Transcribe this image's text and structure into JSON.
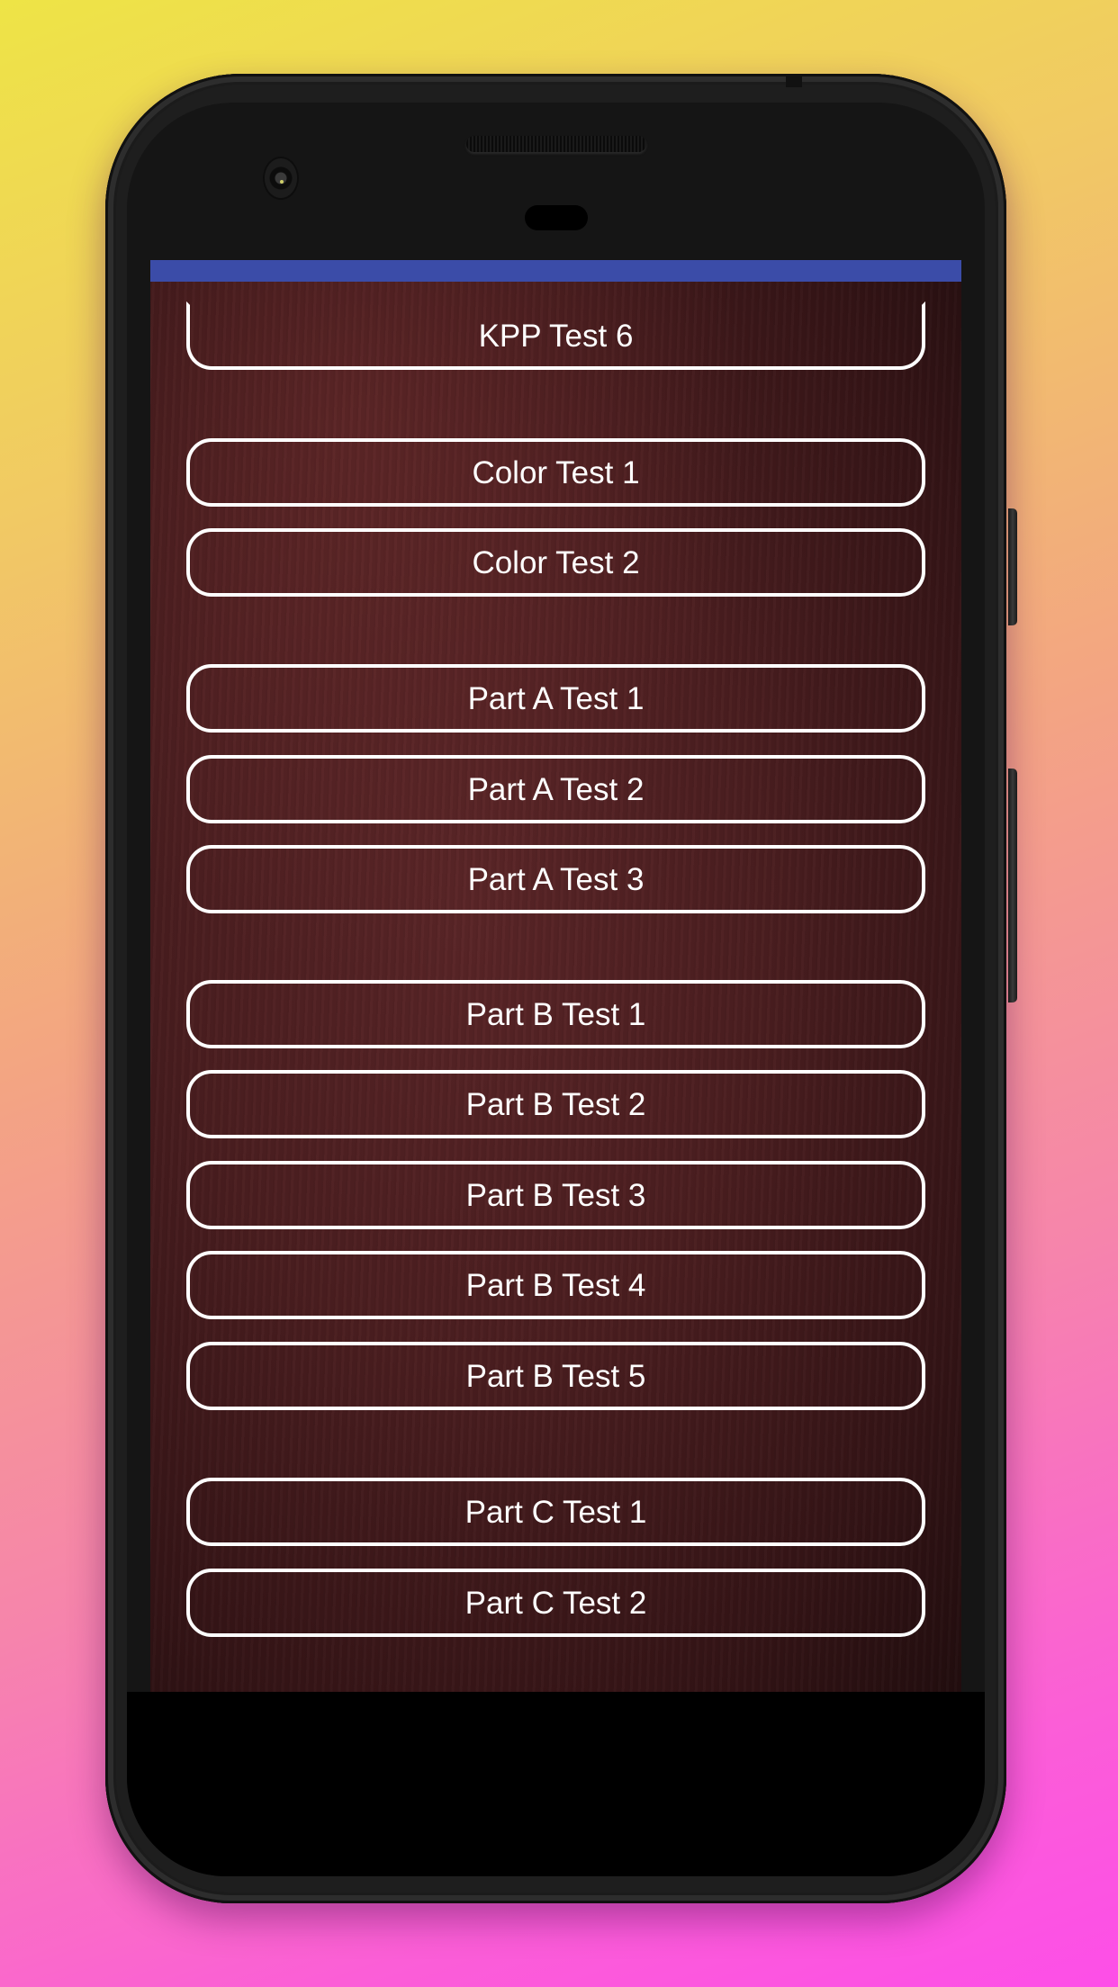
{
  "app": {
    "status_bar_color": "#3b4ca8",
    "button_border_color": "#ffffff",
    "button_text_color": "#ffffff"
  },
  "tests": {
    "kpp": [
      {
        "label": "KPP Test 6"
      }
    ],
    "color": [
      {
        "label": "Color Test 1"
      },
      {
        "label": "Color Test 2"
      }
    ],
    "part_a": [
      {
        "label": "Part A Test 1"
      },
      {
        "label": "Part A Test 2"
      },
      {
        "label": "Part A Test 3"
      }
    ],
    "part_b": [
      {
        "label": "Part B Test 1"
      },
      {
        "label": "Part B Test 2"
      },
      {
        "label": "Part B Test 3"
      },
      {
        "label": "Part B Test 4"
      },
      {
        "label": "Part B Test 5"
      }
    ],
    "part_c": [
      {
        "label": "Part C Test 1"
      },
      {
        "label": "Part C Test 2"
      }
    ]
  },
  "device": {
    "icons": [
      "front-camera-icon",
      "earpiece-speaker-icon",
      "proximity-sensor-icon"
    ]
  }
}
